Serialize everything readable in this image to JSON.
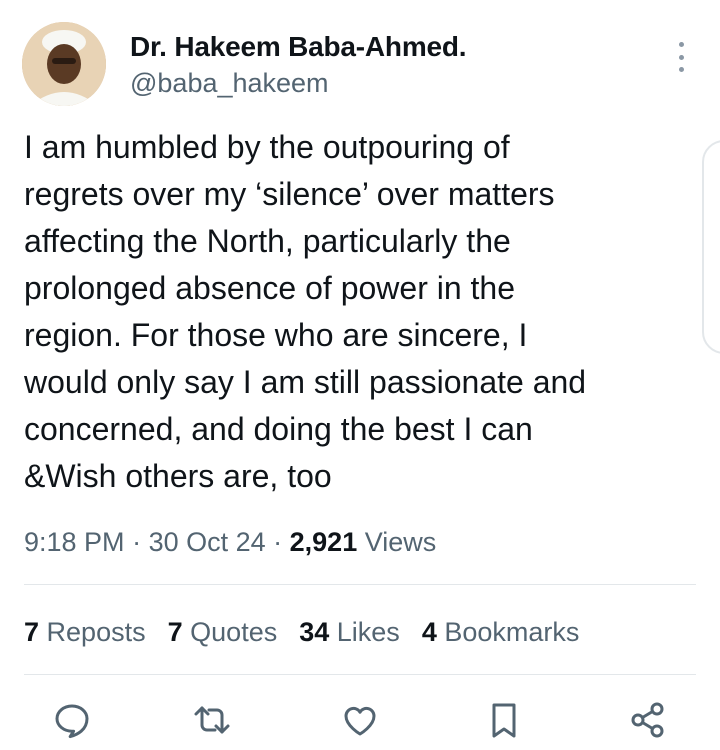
{
  "user": {
    "display_name": "Dr. Hakeem Baba-Ahmed.",
    "handle": "@baba_hakeem"
  },
  "tweet": {
    "text": "I am humbled by the outpouring of\nregrets over my ‘silence’ over matters\naffecting the North, particularly the\nprolonged absence of power in the\nregion. For those who are sincere, I\nwould only say I am still passionate and\nconcerned, and doing the best I can\n&Wish others are, too"
  },
  "meta": {
    "time": "9:18 PM",
    "sep1": " · ",
    "date": "30 Oct 24",
    "sep2": " · ",
    "views_count": "2,921",
    "views_label": " Views"
  },
  "stats": {
    "reposts": {
      "count": "7",
      "label": "Reposts"
    },
    "quotes": {
      "count": "7",
      "label": "Quotes"
    },
    "likes": {
      "count": "34",
      "label": "Likes"
    },
    "bookmarks": {
      "count": "4",
      "label": "Bookmarks"
    }
  },
  "actions": [
    "reply-icon",
    "repost-icon",
    "like-icon",
    "bookmark-icon",
    "share-icon"
  ],
  "colors": {
    "text": "#0f1419",
    "secondary": "#536471",
    "divider": "#e3e7ea",
    "icon": "#536471"
  }
}
